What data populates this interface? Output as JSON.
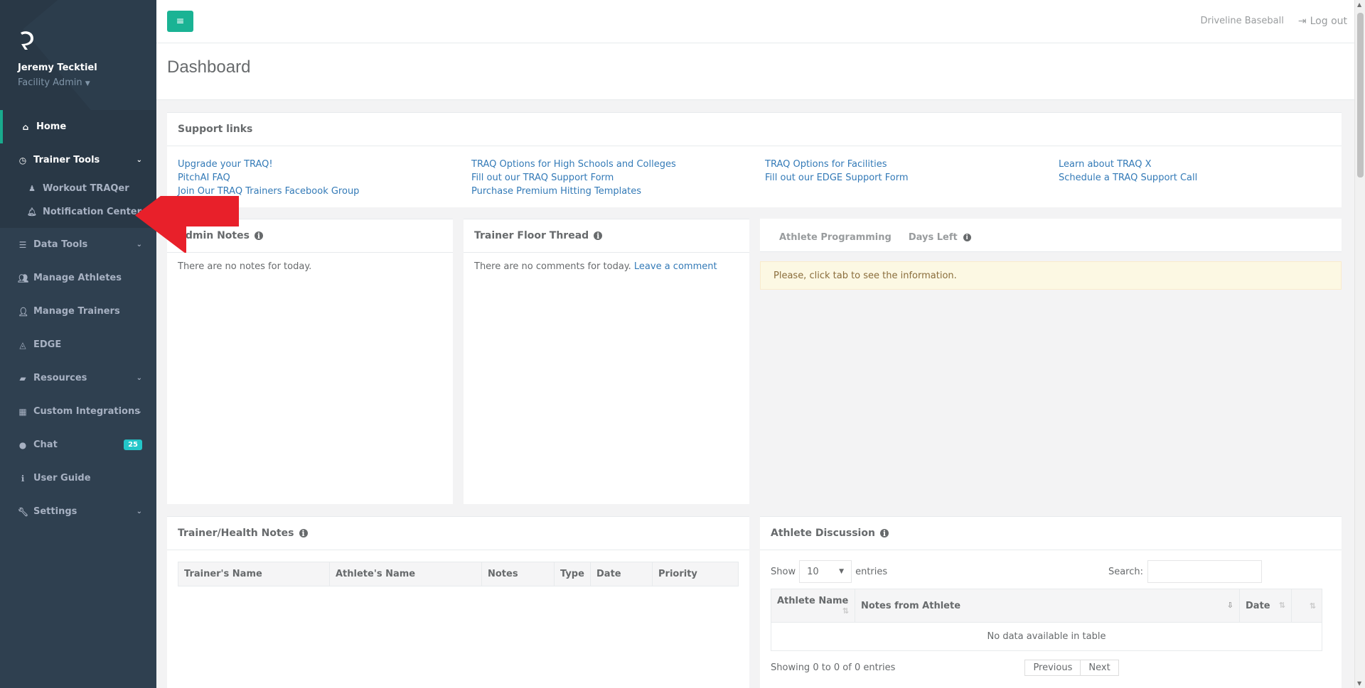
{
  "sidebar": {
    "user_name": "Jeremy Tecktiel",
    "user_role": "Facility Admin",
    "items": [
      {
        "label": "Home",
        "icon": "home-icon"
      },
      {
        "label": "Trainer Tools",
        "icon": "clock-icon"
      },
      {
        "label": "Data Tools",
        "icon": "list-icon"
      },
      {
        "label": "Manage Athletes",
        "icon": "users-icon"
      },
      {
        "label": "Manage Trainers",
        "icon": "user-plus-icon"
      },
      {
        "label": "EDGE",
        "icon": "area-chart-icon"
      },
      {
        "label": "Resources",
        "icon": "book-icon"
      },
      {
        "label": "Custom Integrations",
        "icon": "grid-icon"
      },
      {
        "label": "Chat",
        "icon": "comment-icon",
        "badge": "25"
      },
      {
        "label": "User Guide",
        "icon": "info-icon"
      },
      {
        "label": "Settings",
        "icon": "wrench-icon"
      }
    ],
    "subitems": [
      {
        "label": "Workout TRAQer",
        "icon": "figure-icon"
      },
      {
        "label": "Notification Center",
        "icon": "bell-icon"
      }
    ]
  },
  "topbar": {
    "org": "Driveline Baseball",
    "logout": "Log out"
  },
  "page": {
    "title": "Dashboard"
  },
  "support": {
    "title": "Support links",
    "columns": [
      [
        "Upgrade your TRAQ!",
        "PitchAI FAQ",
        "Join Our TRAQ Trainers Facebook Group"
      ],
      [
        "TRAQ Options for High Schools and Colleges",
        "Fill out our TRAQ Support Form",
        "Purchase Premium Hitting Templates"
      ],
      [
        "TRAQ Options for Facilities",
        "Fill out our EDGE Support Form"
      ],
      [
        "Learn about TRAQ X",
        "Schedule a TRAQ Support Call"
      ]
    ]
  },
  "admin_notes": {
    "title": "Admin Notes",
    "empty": "There are no notes for today."
  },
  "floor_thread": {
    "title": "Trainer Floor Thread",
    "empty": "There are no comments for today.",
    "link": "Leave a comment"
  },
  "athlete_tabs": {
    "tabs": [
      "Athlete Programming",
      "Days Left"
    ],
    "alert": "Please, click tab to see the information."
  },
  "health_notes": {
    "title": "Trainer/Health Notes",
    "columns": [
      "Trainer's Name",
      "Athlete's Name",
      "Notes",
      "Type",
      "Date",
      "Priority"
    ]
  },
  "discussion": {
    "title": "Athlete Discussion",
    "show": "Show",
    "entries_value": "10",
    "entries": "entries",
    "search": "Search:",
    "columns": [
      "Athlete Name",
      "Notes from Athlete",
      "Date",
      ""
    ],
    "no_data": "No data available in table",
    "info": "Showing 0 to 0 of 0 entries",
    "prev": "Previous",
    "next": "Next"
  },
  "colors": {
    "sidebar": "#2f4050",
    "accent": "#1ab394",
    "link": "#337ab7",
    "badge": "#23c6c8",
    "annotation_arrow": "#e8202a"
  }
}
